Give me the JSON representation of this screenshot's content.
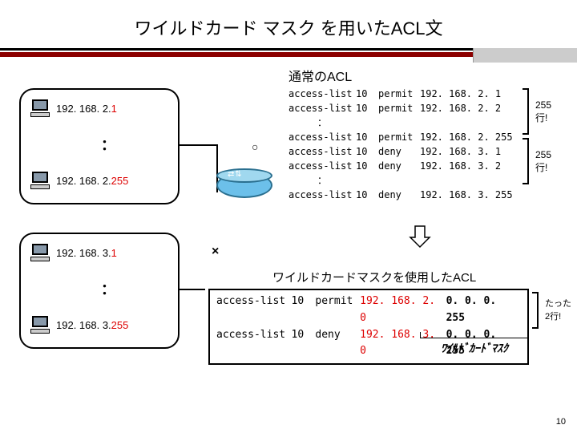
{
  "title": "ワイルドカード マスク を用いたACL文",
  "network": {
    "subnet1": {
      "first_prefix": "192. 168. 2.",
      "first_suffix": "1",
      "last_prefix": "192. 168. 2.",
      "last_suffix": "255"
    },
    "subnet2": {
      "first_prefix": "192. 168. 3.",
      "first_suffix": "1",
      "last_prefix": "192. 168. 3.",
      "last_suffix": "255"
    },
    "ok_symbol": "○",
    "ng_symbol": "×",
    "vdots": "："
  },
  "normal_acl": {
    "header": "通常のACL",
    "rows": [
      {
        "cmd": "access-list",
        "id": "10",
        "action": "permit",
        "addr": "192. 168. 2. 1"
      },
      {
        "cmd": "access-list",
        "id": "10",
        "action": "permit",
        "addr": "192. 168. 2. 2"
      }
    ],
    "dots1": "：",
    "rows2": [
      {
        "cmd": "access-list",
        "id": "10",
        "action": "permit",
        "addr": "192. 168. 2. 255"
      },
      {
        "cmd": "access-list",
        "id": "10",
        "action": "deny",
        "addr": "192. 168. 3. 1"
      },
      {
        "cmd": "access-list",
        "id": "10",
        "action": "deny",
        "addr": "192. 168. 3. 2"
      }
    ],
    "dots2": "：",
    "rows3": [
      {
        "cmd": "access-list",
        "id": "10",
        "action": "deny",
        "addr": "192. 168. 3. 255"
      }
    ],
    "count_label_1a": "255",
    "count_label_1b": "行!",
    "count_label_2a": "255",
    "count_label_2b": "行!"
  },
  "wildcard_acl": {
    "header": "ワイルドカードマスクを使用したACL",
    "rows": [
      {
        "cmd": "access-list",
        "id": "10",
        "action": "permit",
        "net": "192. 168. 2. 0",
        "mask": "0. 0. 0. 255"
      },
      {
        "cmd": "access-list",
        "id": "10",
        "action": "deny",
        "net": "192. 168. 3. 0",
        "mask": "0. 0. 0. 255"
      }
    ],
    "count_a": "たった",
    "count_b": "2行!",
    "mask_label": "ﾜｲﾙﾄﾞｶｰﾄﾞﾏｽｸ"
  },
  "page_number": "10"
}
